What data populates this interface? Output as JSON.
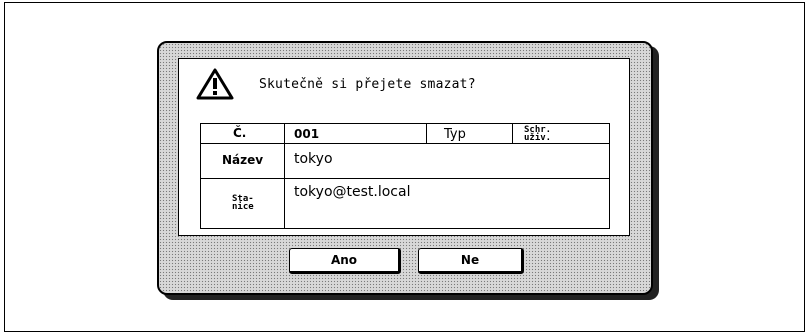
{
  "dialog": {
    "question": "Skutečně si přejete smazat?",
    "icon": "warning-triangle-icon"
  },
  "table": {
    "number_label": "Č.",
    "number_value": "001",
    "type_label": "Typ",
    "user_box_label_line1": "Schr.",
    "user_box_label_line2": "uživ.",
    "name_label": "Název",
    "name_value": "tokyo",
    "station_label_line1": "Sta-",
    "station_label_line2": "nice",
    "station_value": "tokyo@test.local"
  },
  "buttons": {
    "yes_label": "Ano",
    "no_label": "Ne"
  }
}
